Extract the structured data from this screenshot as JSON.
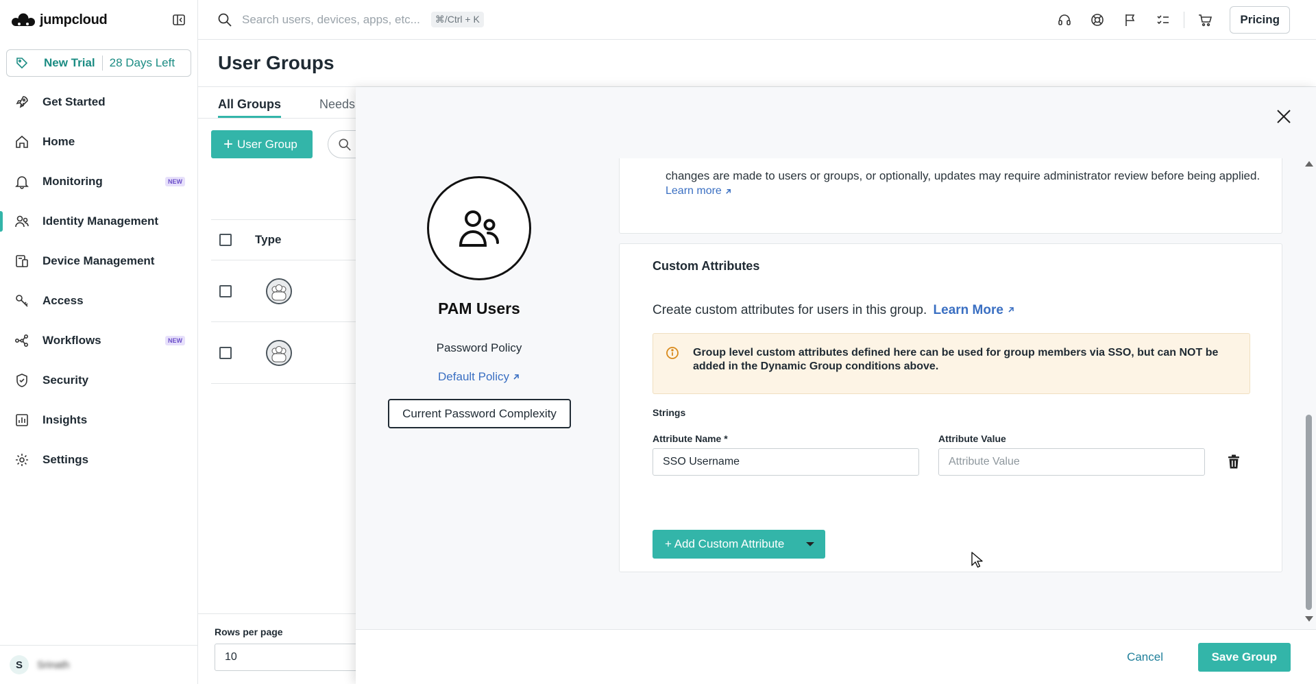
{
  "app": {
    "brand": "jumpcloud",
    "accent": "#33b5a9"
  },
  "trial": {
    "label": "New Trial",
    "days_left": "28 Days Left"
  },
  "sidebar": {
    "items": [
      {
        "label": "Get Started",
        "icon": "rocket-icon",
        "badge": ""
      },
      {
        "label": "Home",
        "icon": "home-icon",
        "badge": ""
      },
      {
        "label": "Monitoring",
        "icon": "bell-icon",
        "badge": "NEW"
      },
      {
        "label": "Identity Management",
        "icon": "users-icon",
        "badge": "",
        "active": true
      },
      {
        "label": "Device Management",
        "icon": "devices-icon",
        "badge": ""
      },
      {
        "label": "Access",
        "icon": "key-icon",
        "badge": ""
      },
      {
        "label": "Workflows",
        "icon": "workflow-icon",
        "badge": "NEW"
      },
      {
        "label": "Security",
        "icon": "shield-icon",
        "badge": ""
      },
      {
        "label": "Insights",
        "icon": "chart-icon",
        "badge": ""
      },
      {
        "label": "Settings",
        "icon": "gear-icon",
        "badge": ""
      }
    ],
    "user": {
      "initial": "S",
      "name": "Srinath"
    }
  },
  "topbar": {
    "search_placeholder": "Search users, devices, apps, etc...",
    "shortcut": "⌘/Ctrl + K",
    "pricing_label": "Pricing"
  },
  "page": {
    "title": "User Groups",
    "tabs": [
      "All Groups",
      "Needs"
    ],
    "add_button": "User Group",
    "type_header": "Type",
    "rows_per_page_label": "Rows per page",
    "rows_per_page_value": "10"
  },
  "drawer": {
    "group_name": "PAM Users",
    "password_policy_label": "Password Policy",
    "password_policy_link": "Default Policy",
    "password_complexity_button": "Current Password Complexity",
    "top_card_text": "changes are made to users or groups, or optionally, updates may require administrator review before being applied.",
    "top_card_link": "Learn more",
    "custom_attributes": {
      "title": "Custom Attributes",
      "description": "Create custom attributes for users in this group.",
      "learn_more": "Learn More",
      "warning": "Group level custom attributes defined here can be used for group members via SSO, but can NOT be added in the Dynamic Group conditions above.",
      "strings_label": "Strings",
      "attribute_name_label": "Attribute Name *",
      "attribute_name_value": "SSO Username",
      "attribute_value_label": "Attribute Value",
      "attribute_value_placeholder": "Attribute Value",
      "add_button": "+ Add Custom Attribute"
    },
    "footer": {
      "cancel": "Cancel",
      "save": "Save Group"
    }
  }
}
